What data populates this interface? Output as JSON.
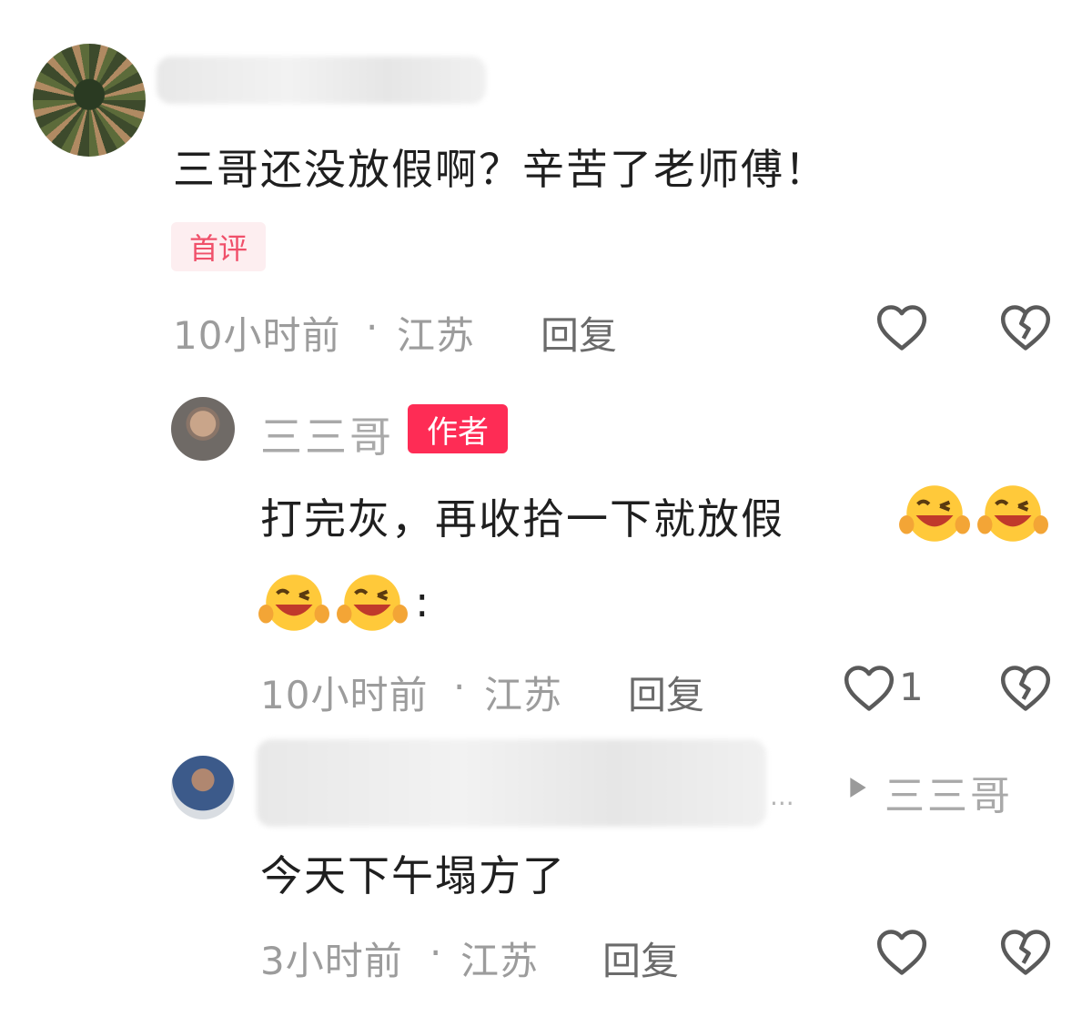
{
  "comments": [
    {
      "text": "三哥还没放假啊？辛苦了老师傅！",
      "badge": "首评",
      "time": "10小时前",
      "location": "江苏",
      "reply_label": "回复",
      "separator": "·"
    },
    {
      "author_name": "三三哥",
      "author_badge": "作者",
      "text_line1": "打完灰，再收拾一下就放假",
      "text_line2_suffix": ":",
      "emoji_name": "grinning-wink-face-emoji",
      "time": "10小时前",
      "location": "江苏",
      "reply_label": "回复",
      "separator": "·",
      "like_count": "1"
    },
    {
      "ellipsis": "...",
      "reply_to": "三三哥",
      "text": "今天下午塌方了",
      "time": "3小时前",
      "location": "江苏",
      "reply_label": "回复",
      "separator": "·"
    }
  ],
  "colors": {
    "author_badge_bg": "#fe2c55",
    "first_badge_bg": "#fdeef0",
    "first_badge_text": "#f0506a",
    "meta_text": "#9c9c9c"
  }
}
